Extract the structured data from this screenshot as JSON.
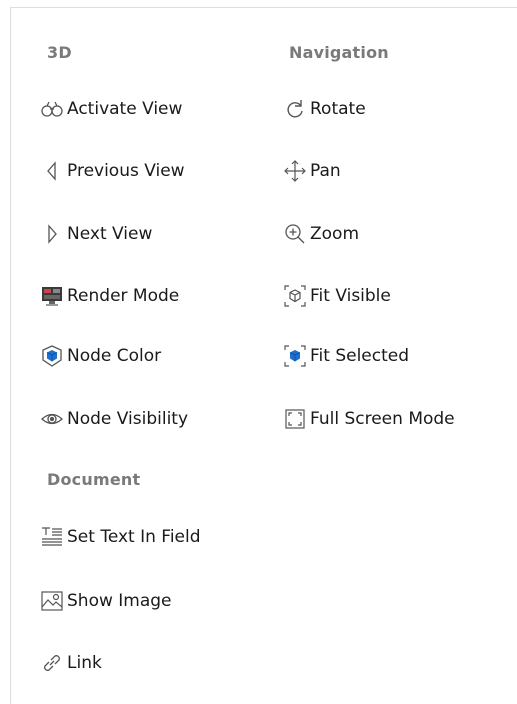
{
  "sections": {
    "three_d": {
      "title": "3D",
      "items": [
        {
          "label": "Activate View",
          "icon": "binoculars-icon"
        },
        {
          "label": "Previous View",
          "icon": "triangle-left-icon"
        },
        {
          "label": "Next View",
          "icon": "triangle-right-icon"
        },
        {
          "label": "Render Mode",
          "icon": "monitor-icon"
        },
        {
          "label": "Node Color",
          "icon": "cube-shield-icon"
        },
        {
          "label": "Node Visibility",
          "icon": "eye-icon"
        }
      ]
    },
    "navigation": {
      "title": "Navigation",
      "items": [
        {
          "label": "Rotate",
          "icon": "rotate-icon"
        },
        {
          "label": "Pan",
          "icon": "pan-arrows-icon"
        },
        {
          "label": "Zoom",
          "icon": "zoom-icon"
        },
        {
          "label": "Fit Visible",
          "icon": "fit-visible-icon"
        },
        {
          "label": "Fit Selected",
          "icon": "fit-selected-icon"
        },
        {
          "label": "Full Screen Mode",
          "icon": "full-screen-icon"
        }
      ]
    },
    "document": {
      "title": "Document",
      "items": [
        {
          "label": "Set Text In Field",
          "icon": "text-field-icon"
        },
        {
          "label": "Show Image",
          "icon": "image-icon"
        },
        {
          "label": "Link",
          "icon": "link-icon"
        }
      ]
    }
  },
  "colors": {
    "heading": "#7a7a7a",
    "icon_stroke": "#555555",
    "accent_blue": "#1f6fd1"
  }
}
